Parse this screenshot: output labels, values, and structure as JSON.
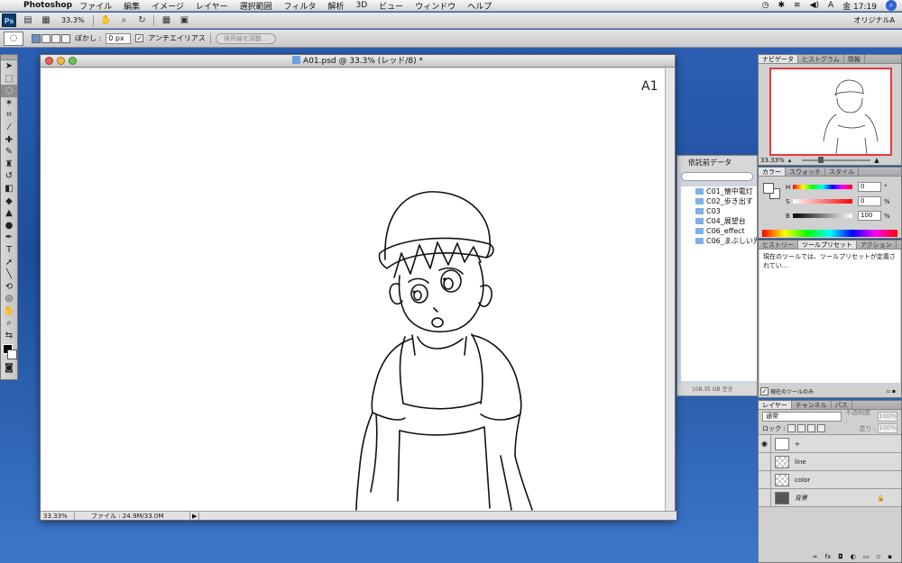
{
  "menubar": {
    "app_name": "Photoshop",
    "items": [
      "ファイル",
      "編集",
      "イメージ",
      "レイヤー",
      "選択範囲",
      "フィルタ",
      "解析",
      "3D",
      "ビュー",
      "ウィンドウ",
      "ヘルプ"
    ],
    "clock": "金 17:19"
  },
  "appbar": {
    "logo": "Ps",
    "zoom": "33.3%",
    "workspace": "オリジナルA"
  },
  "options": {
    "feather_label": "ぼかし :",
    "feather_value": "0 px",
    "antialias_label": "アンチエイリアス",
    "refine_edge": "境界線を調整..."
  },
  "document": {
    "title": "A01.psd @ 33.3% (レッド/8) *",
    "page_mark": "A1",
    "status_zoom": "33.33%",
    "status_file": "ファイル : 24.9M/33.0M"
  },
  "bridge": {
    "header": "依託前データ",
    "folders": [
      "C01_懐中電灯",
      "C02_歩き出す",
      "C03",
      "C04_展望台",
      "C06_effect",
      "C06_まぶしい光..."
    ],
    "footer": "108.35 GB 空き"
  },
  "navigator": {
    "tabs": [
      "ナビゲータ",
      "ヒストグラム",
      "情報"
    ],
    "zoom": "33.33%"
  },
  "color": {
    "tabs": [
      "カラー",
      "スウォッチ",
      "スタイル"
    ],
    "h": {
      "label": "H",
      "value": "0",
      "unit": "°"
    },
    "s": {
      "label": "S",
      "value": "0",
      "unit": "%"
    },
    "b": {
      "label": "B",
      "value": "100",
      "unit": "%"
    }
  },
  "presets": {
    "tabs": [
      "ヒストリー",
      "ツールプリセット",
      "アクション"
    ],
    "message": "現在のツールでは、ツールプリセットが定義されてい...",
    "current_only": "現在のツールのみ"
  },
  "layers": {
    "tabs": [
      "レイヤー",
      "チャンネル",
      "パス"
    ],
    "blend_mode": "通常",
    "opacity_label": "不透明度 :",
    "opacity_value": "100%",
    "lock_label": "ロック :",
    "fill_label": "塗り :",
    "fill_value": "100%",
    "items": [
      {
        "name": "+"
      },
      {
        "name": "line"
      },
      {
        "name": "color"
      },
      {
        "name": "背景"
      }
    ]
  }
}
